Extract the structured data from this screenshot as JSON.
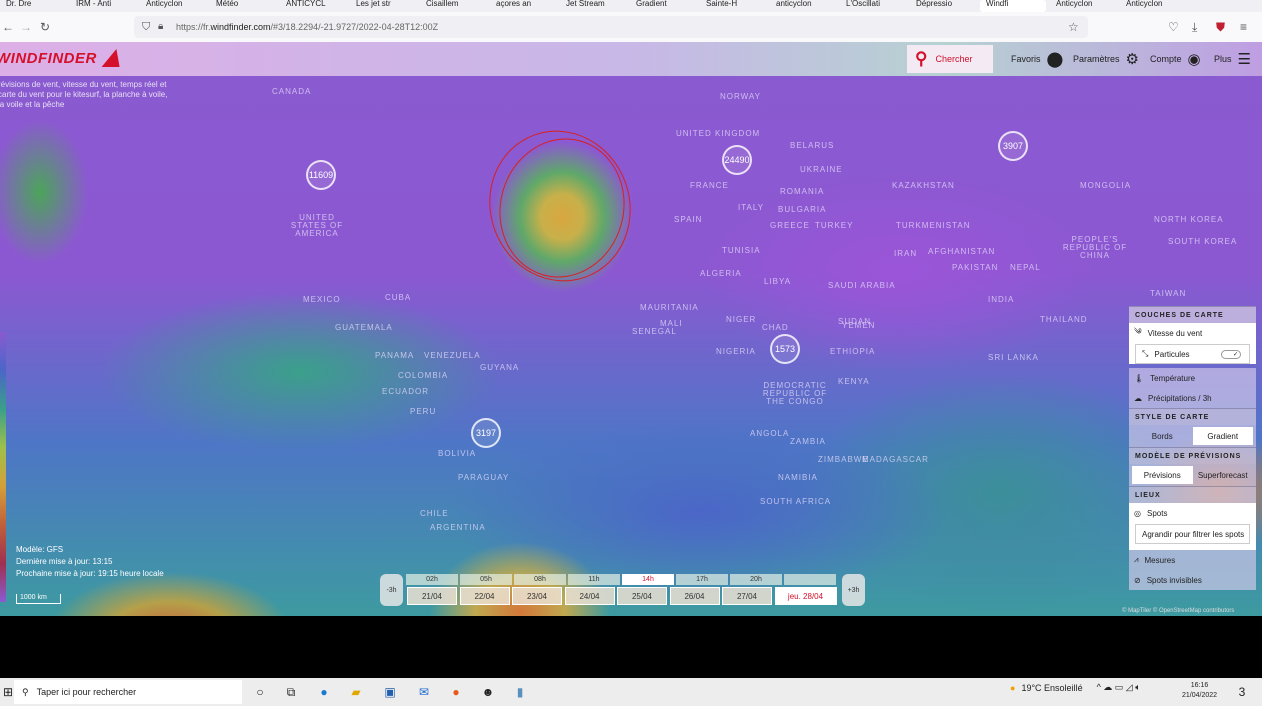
{
  "browser": {
    "tabs": [
      "Dr. Dre",
      "IRM - Anti",
      "Anticyclon",
      "Météo",
      "ANTICYCL",
      "Les jet str",
      "Cisaillem",
      "açores an",
      "Jet Stream",
      "Gradient",
      "Sainte-H",
      "anticyclon",
      "L'Oscillati",
      "Dépressio",
      "Windfi",
      "Anticyclon",
      "Anticyclon"
    ],
    "active_tab": 14,
    "url_prefix": "https://fr.",
    "url_domain": "windfinder.com",
    "url_rest": "/#3/18.2294/-21.9727/2022-04-28T12:00Z"
  },
  "header": {
    "logo": "WINDFINDER",
    "search": "Chercher",
    "favorites": "Favoris",
    "settings": "Paramètres",
    "account": "Compte",
    "more": "Plus"
  },
  "description": "révisions de vent, vitesse du vent, temps réel et carte du vent pour le kitesurf, la planche à voile, la voile et la pêche",
  "map": {
    "countries": [
      "CANADA",
      "UNITED STATES OF AMERICA",
      "MEXICO",
      "CUBA",
      "GUATEMALA",
      "PANAMA",
      "VENEZUELA",
      "GUYANA",
      "COLOMBIA",
      "ECUADOR",
      "PERU",
      "BOLIVIA",
      "PARAGUAY",
      "CHILE",
      "ARGENTINA",
      "NORWAY",
      "UNITED KINGDOM",
      "BELARUS",
      "UKRAINE",
      "FRANCE",
      "ROMANIA",
      "SPAIN",
      "ITALY",
      "BULGARIA",
      "GREECE",
      "TURKEY",
      "TUNISIA",
      "ALGERIA",
      "LIBYA",
      "MAURITANIA",
      "MALI",
      "NIGER",
      "CHAD",
      "SUDAN",
      "NIGERIA",
      "ETHIOPIA",
      "KENYA",
      "DEMOCRATIC REPUBLIC OF THE CONGO",
      "ANGOLA",
      "ZAMBIA",
      "ZIMBABWE",
      "NAMIBIA",
      "SOUTH AFRICA",
      "MADAGASCAR",
      "SAUDI ARABIA",
      "YEMEN",
      "IRAN",
      "AFGHANISTAN",
      "PAKISTAN",
      "NEPAL",
      "INDIA",
      "KAZAKHSTAN",
      "MONGOLIA",
      "TURKMENISTAN",
      "PEOPLE'S REPUBLIC OF CHINA",
      "NORTH KOREA",
      "SOUTH KOREA",
      "TAIWAN",
      "SRI LANKA",
      "THAILAND",
      "SENEGAL"
    ],
    "clusters": [
      "11609",
      "24490",
      "3907",
      "1573",
      "3197"
    ]
  },
  "info": {
    "model": "Modèle: GFS",
    "last_update": "Dernière mise à jour: 13:15",
    "next_update": "Prochaine mise à jour: 19:15 heure locale",
    "scale": "1000 km"
  },
  "timeline": {
    "prev": "-3h",
    "next": "+3h",
    "hours": [
      "02h",
      "05h",
      "08h",
      "11h",
      "14h",
      "17h",
      "20h"
    ],
    "selected_hour": "14h",
    "days": [
      "21/04",
      "22/04",
      "23/04",
      "24/04",
      "25/04",
      "26/04",
      "27/04",
      "jeu. 28/04"
    ],
    "selected_day": "jeu. 28/04"
  },
  "panel": {
    "layers_title": "COUCHES DE CARTE",
    "wind": "Vitesse du vent",
    "particles": "Particules",
    "particles_on": true,
    "temperature": "Température",
    "precip": "Précipitations / 3h",
    "style_title": "STYLE DE CARTE",
    "borders": "Bords",
    "gradient": "Gradient",
    "style_selected": "Gradient",
    "model_title": "MODÈLE DE PRÉVISIONS",
    "forecast": "Prévisions",
    "superforecast": "Superforecast",
    "model_selected": "Prévisions",
    "places_title": "LIEUX",
    "spots": "Spots",
    "spots_hint": "Agrandir pour filtrer les spots",
    "measures": "Mesures",
    "invisible": "Spots invisibles"
  },
  "credits": "© MapTiler © OpenStreetMap contributors",
  "taskbar": {
    "search_placeholder": "Taper ici pour rechercher",
    "weather": "19°C Ensoleillé",
    "time": "16:16",
    "date": "21/04/2022",
    "notifications": "3"
  },
  "colors": {
    "brand": "#d4102a",
    "storm_marker": "#d82020"
  }
}
